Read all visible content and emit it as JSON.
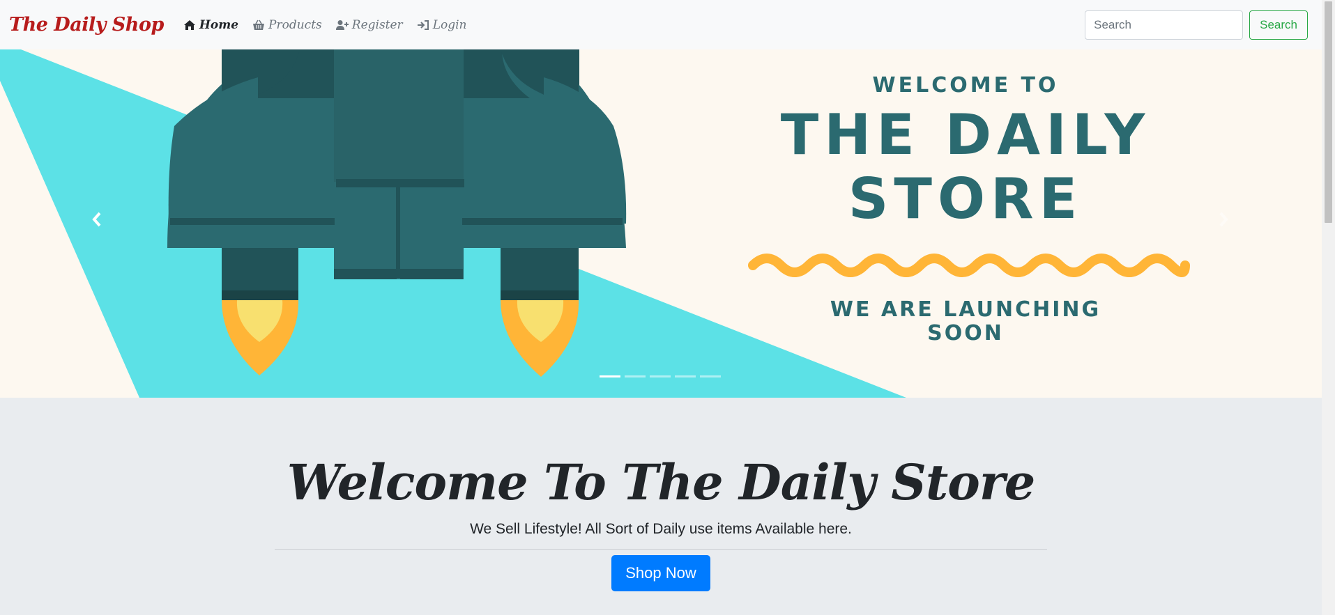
{
  "navbar": {
    "brand": "The Daily Shop",
    "items": [
      {
        "label": "Home",
        "icon": "home-icon",
        "active": true
      },
      {
        "label": "Products",
        "icon": "basket-icon",
        "active": false
      },
      {
        "label": "Register",
        "icon": "user-plus-icon",
        "active": false
      },
      {
        "label": "Login",
        "icon": "sign-in-icon",
        "active": false
      }
    ],
    "search": {
      "placeholder": "Search",
      "button_label": "Search"
    }
  },
  "carousel": {
    "welcome_to": "WELCOME TO",
    "title_line1": "THE DAILY",
    "title_line2": "STORE",
    "subtitle_line1": "WE ARE LAUNCHING",
    "subtitle_line2": "SOON",
    "prev_icon": "chevron-left-icon",
    "next_icon": "chevron-right-icon",
    "slide_count": 5,
    "active_slide": 1
  },
  "jumbotron": {
    "heading": "Welcome To The Daily Store",
    "lead": "We Sell Lifestyle! All Sort of Daily use items Available here.",
    "button_label": "Shop Now"
  },
  "colors": {
    "brand": "#b71c1c",
    "hero_bg": "#fdf8f0",
    "hero_cyan": "#5ce1e6",
    "rocket_teal": "#2b6a70",
    "rocket_dark": "#215358",
    "flame_orange": "#ffb537",
    "flame_yellow": "#f8e06f",
    "primary": "#007bff",
    "success": "#28a745"
  }
}
